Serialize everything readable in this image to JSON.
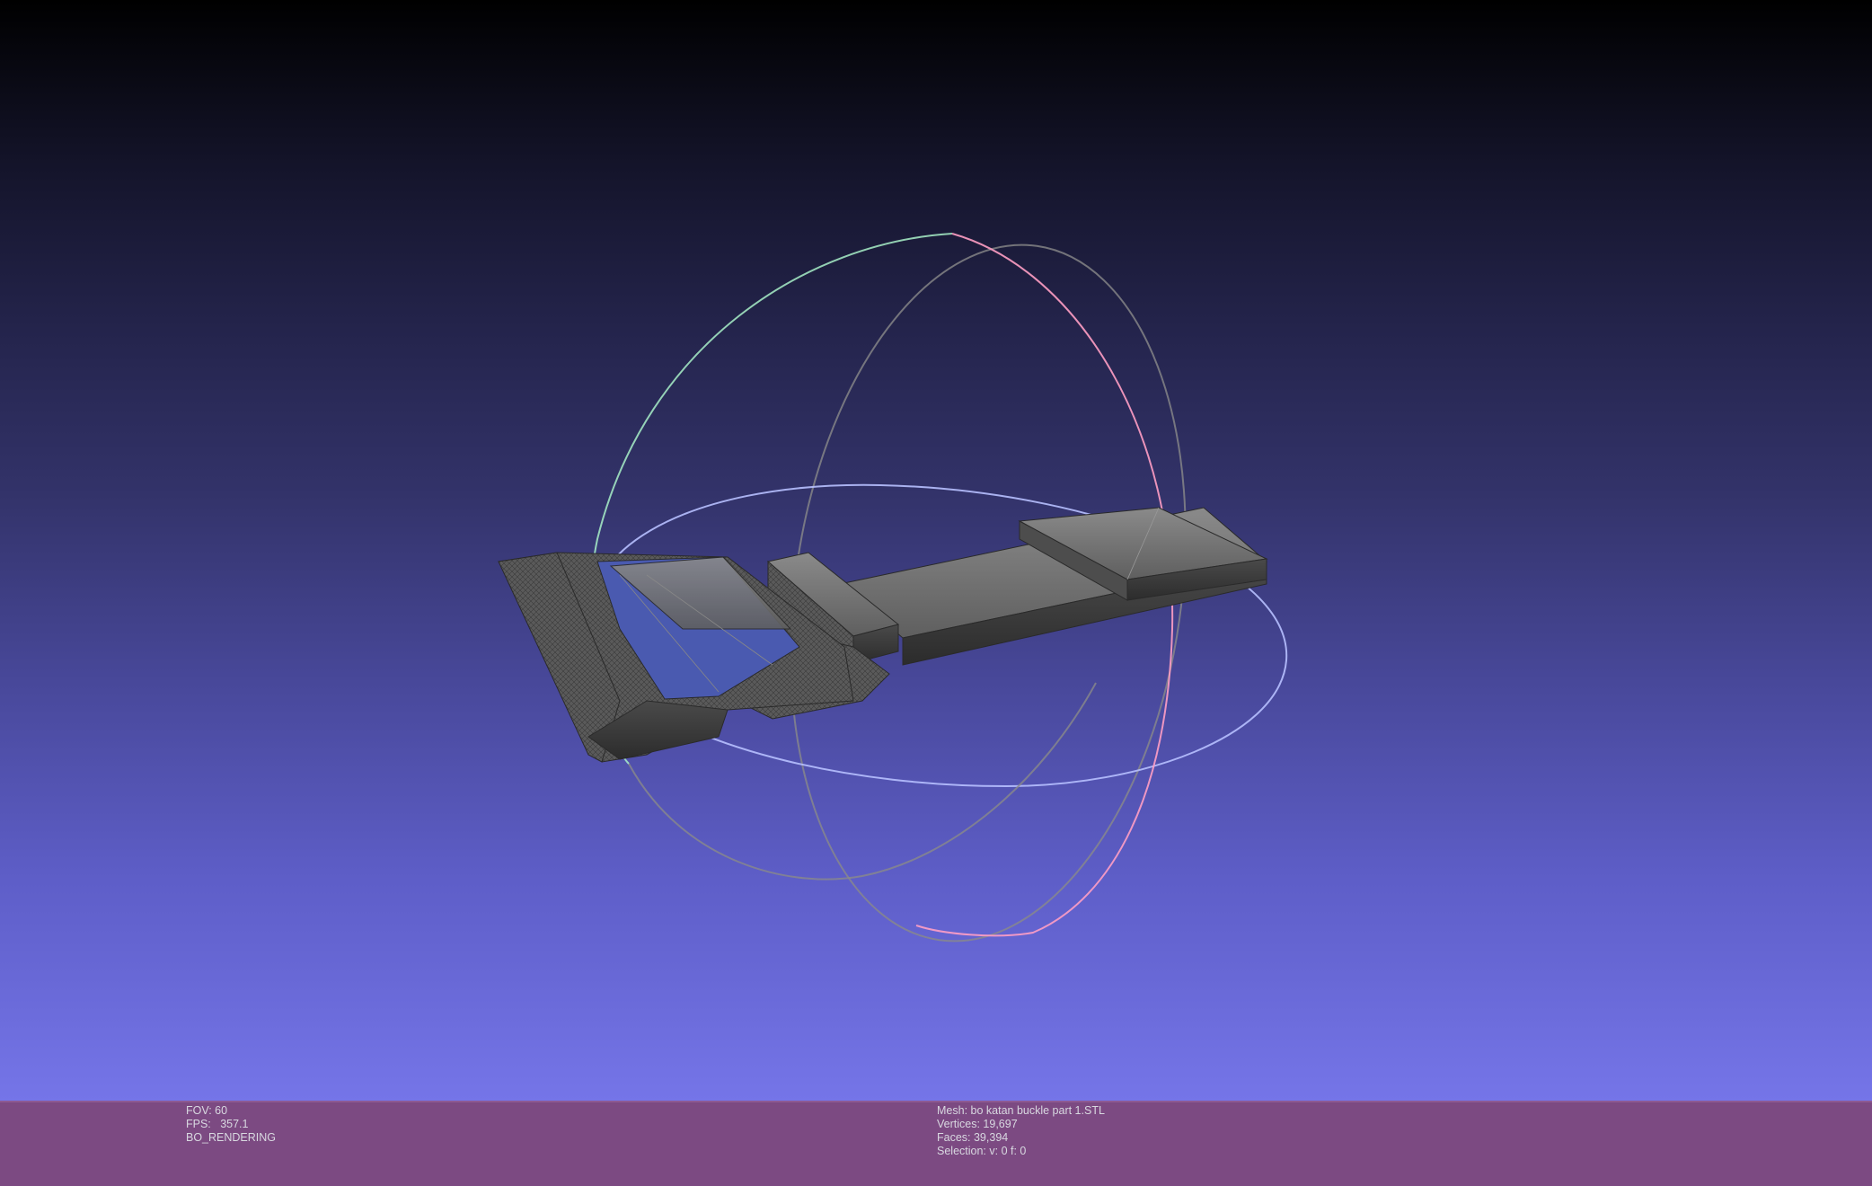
{
  "viewport": {
    "background_top": "#000000",
    "background_bottom": "#7575e8",
    "model": "mesh-wireframe",
    "trackball": {
      "colors": {
        "horizontal_ring": "#b7c0ff",
        "vertical_ring_pink": "#ff9ec4",
        "vertical_ring_green": "#a8f0c8",
        "back_ring": "#8a8a8a"
      }
    }
  },
  "status_bar": {
    "background": "#7c4a82",
    "render_info": {
      "fov": "FOV: 60",
      "fps": "FPS:   357.1",
      "mode": "BO_RENDERING"
    },
    "mesh_info": {
      "mesh": "Mesh: bo katan buckle part 1.STL",
      "vertices": "Vertices: 19,697",
      "faces": "Faces: 39,394",
      "selection": "Selection: v: 0 f: 0"
    }
  }
}
